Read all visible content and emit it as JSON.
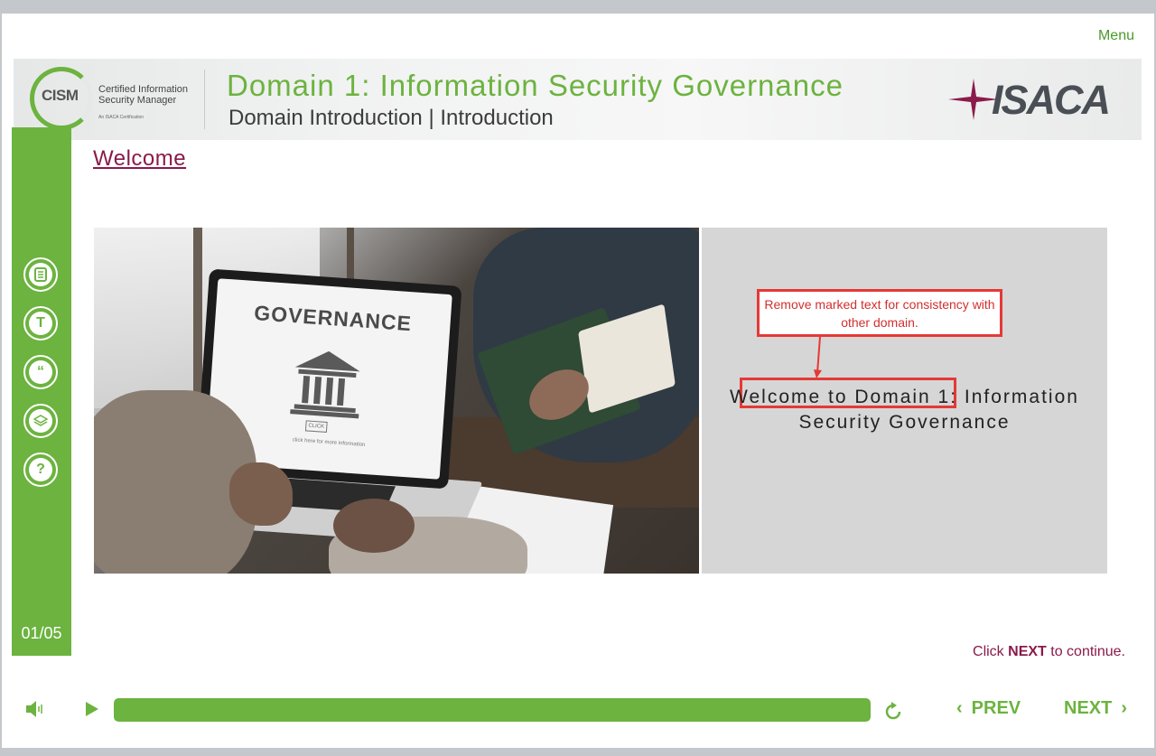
{
  "menu_label": "Menu",
  "header": {
    "logo_acronym": "CISM",
    "logo_subtitle": "Certified Information Security Manager",
    "logo_tagline": "An ISACA Certification",
    "domain_title": "Domain 1: Information Security Governance",
    "domain_subtitle": "Domain Introduction | Introduction",
    "brand": "ISACA"
  },
  "sidebar": {
    "buttons": [
      "notes-icon",
      "transcript-icon",
      "quote-icon",
      "layers-icon",
      "help-icon"
    ],
    "counter": "01/05"
  },
  "page_title": "Welcome",
  "image": {
    "screen_text": "GOVERNANCE",
    "button_text": "CLICK",
    "caption": "click here for more information"
  },
  "panel": {
    "welcome_text": "Welcome to Domain 1: Information Security Governance",
    "annotation": "Remove marked text for consistency with other domain."
  },
  "continue_hint": {
    "prefix": "Click",
    "keyword": "NEXT",
    "suffix": "to continue."
  },
  "controls": {
    "progress": 1.0,
    "prev_label": "PREV",
    "next_label": "NEXT"
  },
  "colors": {
    "accent_green": "#6cb33f",
    "title_maroon": "#8a1a4a",
    "annotation_red": "#e53935"
  }
}
